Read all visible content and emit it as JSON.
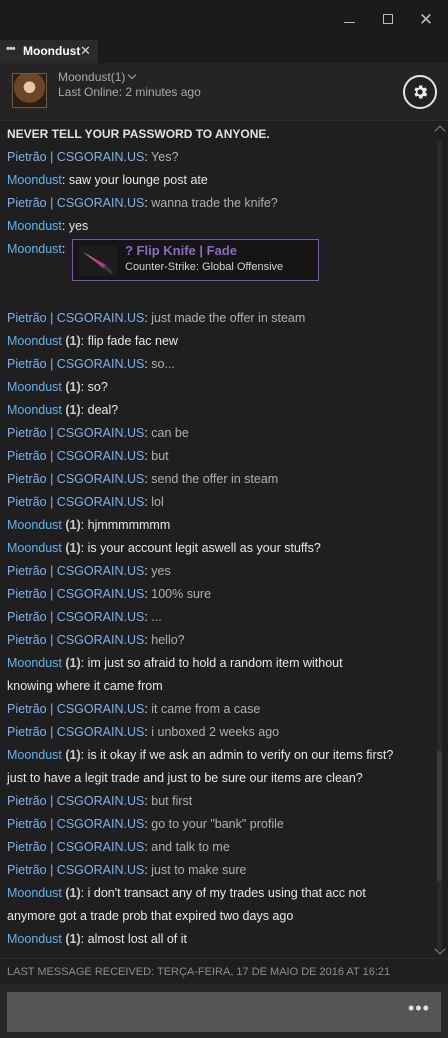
{
  "window": {
    "minimize_icon": "minimize-icon",
    "maximize_icon": "maximize-icon",
    "close_icon": "close-icon",
    "close_glyph": "✕"
  },
  "tab": {
    "dots": "•••",
    "label": "Moondust",
    "close_glyph": "✕"
  },
  "header": {
    "friend_name": "Moondust(1)",
    "last_online": "Last Online: 2 minutes ago",
    "settings_icon": "gear-icon"
  },
  "colors": {
    "friend_name": "#7fb2e8",
    "self_name": "#5fb4f0",
    "item_border": "#7b5aa9",
    "item_name": "#8e6ac4"
  },
  "chat": {
    "warning": "NEVER TELL YOUR PASSWORD TO ANYONE.",
    "item_card": {
      "name": "? Flip Knife | Fade",
      "game": "Counter-Strike: Global Offensive"
    },
    "messages": [
      {
        "who": "friend",
        "sender": "Pietrão | CSGORAIN.US",
        "count": "",
        "text": "Yes?"
      },
      {
        "who": "self",
        "sender": "Moondust",
        "count": "",
        "text": "saw your lounge post ate"
      },
      {
        "who": "friend",
        "sender": "Pietrão | CSGORAIN.US",
        "count": "",
        "text": "wanna trade the knife?"
      },
      {
        "who": "self",
        "sender": "Moondust",
        "count": "",
        "text": "yes"
      },
      {
        "who": "self",
        "sender": "Moondust",
        "count": "",
        "text": ""
      },
      {
        "who": "friend",
        "sender": "Pietrão | CSGORAIN.US",
        "count": "",
        "text": "just made the offer in steam"
      },
      {
        "who": "self",
        "sender": "Moondust",
        "count": "(1)",
        "text": "flip fade fac new"
      },
      {
        "who": "friend",
        "sender": "Pietrão | CSGORAIN.US",
        "count": "",
        "text": "so..."
      },
      {
        "who": "self",
        "sender": "Moondust",
        "count": "(1)",
        "text": "so?"
      },
      {
        "who": "self",
        "sender": "Moondust",
        "count": "(1)",
        "text": "deal?"
      },
      {
        "who": "friend",
        "sender": "Pietrão | CSGORAIN.US",
        "count": "",
        "text": "can be"
      },
      {
        "who": "friend",
        "sender": "Pietrão | CSGORAIN.US",
        "count": "",
        "text": "but"
      },
      {
        "who": "friend",
        "sender": "Pietrão | CSGORAIN.US",
        "count": "",
        "text": "send the offer in steam"
      },
      {
        "who": "friend",
        "sender": "Pietrão | CSGORAIN.US",
        "count": "",
        "text": "lol"
      },
      {
        "who": "self",
        "sender": "Moondust",
        "count": "(1)",
        "text": "hjmmmmmmm"
      },
      {
        "who": "self",
        "sender": "Moondust",
        "count": "(1)",
        "text": "is your account legit aswell as your stuffs?"
      },
      {
        "who": "friend",
        "sender": "Pietrão | CSGORAIN.US",
        "count": "",
        "text": "yes"
      },
      {
        "who": "friend",
        "sender": "Pietrão | CSGORAIN.US",
        "count": "",
        "text": "100% sure"
      },
      {
        "who": "friend",
        "sender": "Pietrão | CSGORAIN.US",
        "count": "",
        "text": "..."
      },
      {
        "who": "friend",
        "sender": "Pietrão | CSGORAIN.US",
        "count": "",
        "text": "hello?"
      },
      {
        "who": "self",
        "sender": "Moondust",
        "count": "(1)",
        "text": "im just so afraid to hold a random item without",
        "cont": "knowing where it came from"
      },
      {
        "who": "friend",
        "sender": "Pietrão | CSGORAIN.US",
        "count": "",
        "text": "it came from a case"
      },
      {
        "who": "friend",
        "sender": "Pietrão | CSGORAIN.US",
        "count": "",
        "text": "i unboxed 2 weeks ago"
      },
      {
        "who": "self",
        "sender": "Moondust",
        "count": "(1)",
        "text": "is it okay if we ask an admin to verify on our items first?",
        "cont": "just to have a legit trade and just to be sure our items are clean?"
      },
      {
        "who": "friend",
        "sender": "Pietrão | CSGORAIN.US",
        "count": "",
        "text": "but first"
      },
      {
        "who": "friend",
        "sender": "Pietrão | CSGORAIN.US",
        "count": "",
        "text": "go to your \"bank\" profile"
      },
      {
        "who": "friend",
        "sender": "Pietrão | CSGORAIN.US",
        "count": "",
        "text": "and talk to me"
      },
      {
        "who": "friend",
        "sender": "Pietrão | CSGORAIN.US",
        "count": "",
        "text": "just to make sure"
      },
      {
        "who": "self",
        "sender": "Moondust",
        "count": "(1)",
        "text": "i don't transact any of my trades using that acc not",
        "cont": "anymore got a trade prob that expired two days ago"
      },
      {
        "who": "self",
        "sender": "Moondust",
        "count": "(1)",
        "text": "almost lost all of it"
      }
    ]
  },
  "status": {
    "last_received": "LAST MESSAGE RECEIVED: TERÇA-FEIRA, 17 DE MAIO DE 2016 AT 16:21"
  },
  "composer": {
    "placeholder": "",
    "more_label": "•••"
  }
}
